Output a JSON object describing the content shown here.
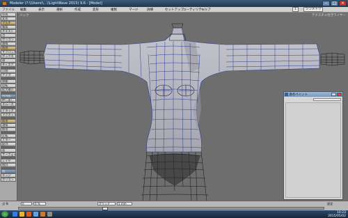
{
  "window": {
    "title": "Modeler (?:\\\\Users\\\\...\\\\LightWave 2015) 9.6 - [Model]"
  },
  "menubar": {
    "items": [
      "ファイル",
      "編集",
      "表示",
      "選択",
      "作成",
      "変形",
      "複製",
      "マージ",
      "詳細",
      "セットアップ",
      "ユーティリティ",
      "ヘルプ"
    ],
    "right_controls": [
      "1",
      "シンメトリ"
    ]
  },
  "toolbar": {
    "items": [
      {
        "label": "作成",
        "style": "normal"
      },
      {
        "label": "変形",
        "style": "normal"
      },
      {
        "label": "マルチ",
        "style": "hl"
      },
      {
        "label": "複製",
        "style": "normal"
      },
      {
        "label": "テキスト",
        "style": "normal"
      },
      {
        "label": "点",
        "style": "normal"
      },
      {
        "label": "ポリゴン",
        "style": "normal"
      },
      {
        "label": "曲線",
        "style": "normal"
      },
      {
        "label": "削除",
        "style": "hl"
      },
      {
        "label": "サブパッチ",
        "style": "normal"
      },
      {
        "label": "ボックス",
        "style": "normal"
      },
      {
        "label": "球",
        "style": "normal"
      },
      {
        "label": "ディスク",
        "style": "normal"
      },
      {
        "label": "",
        "style": "dark"
      },
      {
        "label": "分割",
        "style": "normal"
      },
      {
        "label": "ナイフ",
        "style": "normal"
      },
      {
        "label": "",
        "style": "dark"
      },
      {
        "label": "移動",
        "style": "normal"
      },
      {
        "label": "回転",
        "style": "normal"
      },
      {
        "label": "拡大縮小",
        "style": "normal"
      },
      {
        "label": "",
        "style": "dark"
      },
      {
        "label": "ベベル",
        "style": "sel"
      },
      {
        "label": "押し出し",
        "style": "normal"
      },
      {
        "label": "スムース",
        "style": "normal"
      },
      {
        "label": "",
        "style": "dark"
      },
      {
        "label": "ドラッグ",
        "style": "normal"
      },
      {
        "label": "マグネット",
        "style": "normal"
      },
      {
        "label": "",
        "style": "dark"
      },
      {
        "label": "結合",
        "style": "hl"
      },
      {
        "label": "溶接",
        "style": "normal"
      },
      {
        "label": "統合",
        "style": "normal"
      },
      {
        "label": "",
        "style": "dark"
      },
      {
        "label": "反転",
        "style": "normal"
      },
      {
        "label": "ミラー",
        "style": "normal"
      },
      {
        "label": "配列",
        "style": "normal"
      },
      {
        "label": "",
        "style": "dark"
      },
      {
        "label": "面",
        "style": "normal"
      },
      {
        "label": "サーフェイス",
        "style": "normal"
      },
      {
        "label": "",
        "style": "dark"
      },
      {
        "label": "レイヤ",
        "style": "normal"
      },
      {
        "label": "統計",
        "style": "normal"
      },
      {
        "label": "",
        "style": "dark"
      },
      {
        "label": "点",
        "style": "sel"
      },
      {
        "label": "エッジ",
        "style": "normal"
      },
      {
        "label": "ポリゴン",
        "style": "normal"
      }
    ]
  },
  "viewport": {
    "label": "バック",
    "shading": "テクスチャ付きワイヤー"
  },
  "floating_panel": {
    "title": "頂点ペイント"
  },
  "status": {
    "left_text": "点 N",
    "fields": [
      "0",
      "0 %",
      "グリッド",
      "5 mm"
    ],
    "tail": "設定"
  },
  "taskbar": {
    "time": "10:23",
    "date": "2015/05/02"
  },
  "colors": {
    "viewport_bg": "#6e6e6e",
    "mesh_fill": "#b4b4bd",
    "wire": "#2a3d8f",
    "cage": "#151515"
  }
}
